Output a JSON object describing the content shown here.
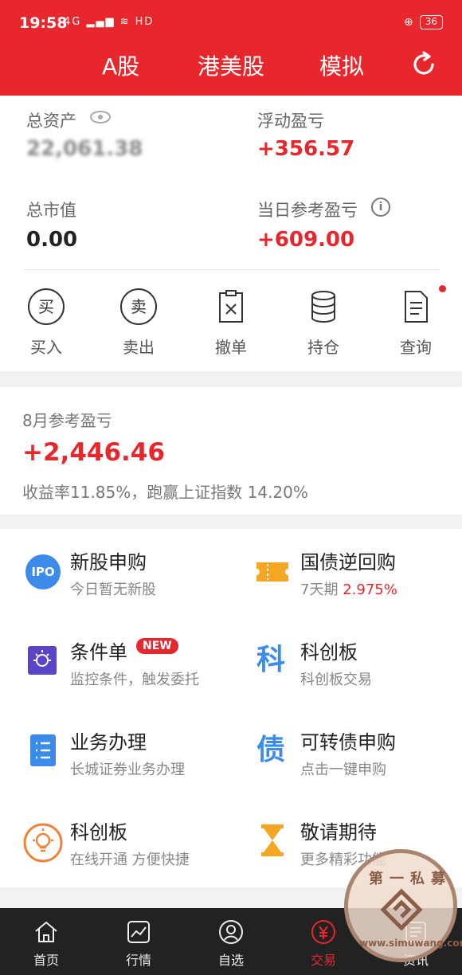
{
  "status": {
    "time": "19:58",
    "net": "4G",
    "hd": "HD",
    "battery": "36"
  },
  "nav": {
    "tabs": [
      "A股",
      "港美股",
      "模拟"
    ]
  },
  "assets": {
    "total_label": "总资产",
    "total_value": "22,061.38",
    "float_label": "浮动盈亏",
    "float_value": "+356.57",
    "market_label": "总市值",
    "market_value": "0.00",
    "daily_label": "当日参考盈亏",
    "daily_value": "+609.00"
  },
  "actions": [
    {
      "label": "买入",
      "glyph": "买"
    },
    {
      "label": "卖出",
      "glyph": "卖"
    },
    {
      "label": "撤单"
    },
    {
      "label": "持仓"
    },
    {
      "label": "查询"
    }
  ],
  "monthly": {
    "label": "8月参考盈亏",
    "value": "+2,446.46",
    "summary": "收益率11.85%，跑赢上证指数 14.20%"
  },
  "services": [
    {
      "title": "新股申购",
      "sub": "今日暂无新股",
      "icon": "IPO"
    },
    {
      "title": "国债逆回购",
      "sub": "7天期",
      "sub_highlight": "2.975%"
    },
    {
      "title": "条件单",
      "sub": "监控条件，触发委托",
      "badge": "NEW"
    },
    {
      "title": "科创板",
      "sub": "科创板交易",
      "icon": "科"
    },
    {
      "title": "业务办理",
      "sub": "长城证券业务办理"
    },
    {
      "title": "可转债申购",
      "sub": "点击一键申购",
      "icon": "债"
    },
    {
      "title": "科创板",
      "sub": "在线开通 方便快捷"
    },
    {
      "title": "敬请期待",
      "sub": "更多精彩功能"
    }
  ],
  "bottom_nav": [
    "首页",
    "行情",
    "自选",
    "交易",
    "资讯"
  ],
  "colors": {
    "brand": "#e8272d",
    "blue": "#3b8beb",
    "orange": "#f5a623"
  },
  "watermark": {
    "text": "第一私募",
    "url": "www.simuwang.com"
  }
}
